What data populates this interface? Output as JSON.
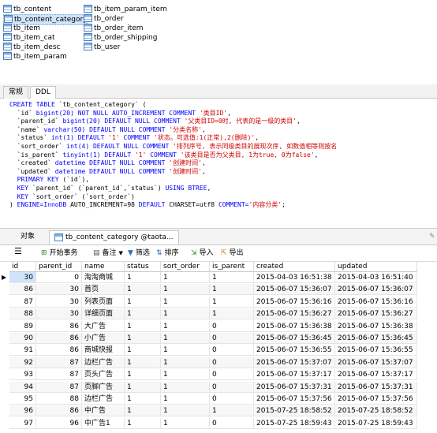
{
  "tables": {
    "col1": [
      "tb_content",
      "tb_content_category",
      "tb_item",
      "tb_item_cat",
      "tb_item_desc",
      "tb_item_param"
    ],
    "col2": [
      "tb_item_param_item",
      "tb_order",
      "tb_order_item",
      "tb_order_shipping",
      "tb_user"
    ],
    "selected": "tb_content_category"
  },
  "ddl_tabs": [
    "常规",
    "DDL"
  ],
  "ddl_lines": [
    [
      [
        "kw",
        "CREATE TABLE "
      ],
      [
        "nm",
        "`tb_content_category` ("
      ]
    ],
    [
      [
        "nm",
        "  `id` "
      ],
      [
        "kw",
        "bigint(20) NOT NULL AUTO_INCREMENT COMMENT "
      ],
      [
        "str",
        "'类目ID'"
      ],
      [
        "nm",
        ","
      ]
    ],
    [
      [
        "nm",
        "  `parent_id` "
      ],
      [
        "kw",
        "bigint(20) DEFAULT NULL COMMENT "
      ],
      [
        "str",
        "'父类目ID=0时, 代表的是一级的类目'"
      ],
      [
        "nm",
        ","
      ]
    ],
    [
      [
        "nm",
        "  `name` "
      ],
      [
        "kw",
        "varchar(50) DEFAULT NULL COMMENT "
      ],
      [
        "str",
        "'分类名称'"
      ],
      [
        "nm",
        ","
      ]
    ],
    [
      [
        "nm",
        "  `status` "
      ],
      [
        "kw",
        "int(1) DEFAULT "
      ],
      [
        "str",
        "'1'"
      ],
      [
        "kw",
        " COMMENT "
      ],
      [
        "str",
        "'状态。可选值:1(正常),2(删除)'"
      ],
      [
        "nm",
        ","
      ]
    ],
    [
      [
        "nm",
        "  `sort_order` "
      ],
      [
        "kw",
        "int(4) DEFAULT NULL COMMENT "
      ],
      [
        "str",
        "'排列序号, 表示同级类目的展现次序, 如数值相等则按名"
      ]
    ],
    [
      [
        "nm",
        "  `is_parent` "
      ],
      [
        "kw",
        "tinyint(1) DEFAULT "
      ],
      [
        "str",
        "'1'"
      ],
      [
        "kw",
        " COMMENT "
      ],
      [
        "str",
        "'该类目是否为父类目, 1为true, 0为false'"
      ],
      [
        "nm",
        ","
      ]
    ],
    [
      [
        "nm",
        "  `created` "
      ],
      [
        "kw",
        "datetime DEFAULT NULL COMMENT "
      ],
      [
        "str",
        "'创建时间'"
      ],
      [
        "nm",
        ","
      ]
    ],
    [
      [
        "nm",
        "  `updated` "
      ],
      [
        "kw",
        "datetime DEFAULT NULL COMMENT "
      ],
      [
        "str",
        "'创建时间'"
      ],
      [
        "nm",
        ","
      ]
    ],
    [
      [
        "kw",
        "  PRIMARY KEY "
      ],
      [
        "nm",
        "(`id`),"
      ]
    ],
    [
      [
        "kw",
        "  KEY "
      ],
      [
        "nm",
        "`parent_id` (`parent_id`,`status`) "
      ],
      [
        "kw",
        "USING BTREE"
      ],
      [
        "nm",
        ","
      ]
    ],
    [
      [
        "kw",
        "  KEY "
      ],
      [
        "nm",
        "`sort_order` (`sort_order`)"
      ]
    ],
    [
      [
        "nm",
        ") "
      ],
      [
        "kw",
        "ENGINE=InnoDB "
      ],
      [
        "nm",
        "AUTO_INCREMENT=98 "
      ],
      [
        "kw",
        "DEFAULT "
      ],
      [
        "nm",
        "CHARSET=utf8 "
      ],
      [
        "kw",
        "COMMENT="
      ],
      [
        "str",
        "'内容分类'"
      ],
      [
        "nm",
        ";"
      ]
    ]
  ],
  "object_tabs": [
    "对象",
    "tb_content_category @taota..."
  ],
  "toolbar": {
    "menu_icon": "hamburger-icon",
    "begin_tx": "开始事务",
    "note": "备注",
    "filter": "筛选",
    "sort": "排序",
    "import": "导入",
    "export": "导出"
  },
  "grid": {
    "columns": [
      "id",
      "parent_id",
      "name",
      "status",
      "sort_order",
      "is_parent",
      "created",
      "updated"
    ],
    "rows": [
      [
        "30",
        "0",
        "淘淘商城",
        "1",
        "1",
        "1",
        "2015-04-03 16:51:38",
        "2015-04-03 16:51:40"
      ],
      [
        "86",
        "30",
        "首页",
        "1",
        "1",
        "1",
        "2015-06-07 15:36:07",
        "2015-06-07 15:36:07"
      ],
      [
        "87",
        "30",
        "列表页面",
        "1",
        "1",
        "1",
        "2015-06-07 15:36:16",
        "2015-06-07 15:36:16"
      ],
      [
        "88",
        "30",
        "详细页面",
        "1",
        "1",
        "1",
        "2015-06-07 15:36:27",
        "2015-06-07 15:36:27"
      ],
      [
        "89",
        "86",
        "大广告",
        "1",
        "1",
        "0",
        "2015-06-07 15:36:38",
        "2015-06-07 15:36:38"
      ],
      [
        "90",
        "86",
        "小广告",
        "1",
        "1",
        "0",
        "2015-06-07 15:36:45",
        "2015-06-07 15:36:45"
      ],
      [
        "91",
        "86",
        "商城快报",
        "1",
        "1",
        "0",
        "2015-06-07 15:36:55",
        "2015-06-07 15:36:55"
      ],
      [
        "92",
        "87",
        "边栏广告",
        "1",
        "1",
        "0",
        "2015-06-07 15:37:07",
        "2015-06-07 15:37:07"
      ],
      [
        "93",
        "87",
        "页头广告",
        "1",
        "1",
        "0",
        "2015-06-07 15:37:17",
        "2015-06-07 15:37:17"
      ],
      [
        "94",
        "87",
        "页脚广告",
        "1",
        "1",
        "0",
        "2015-06-07 15:37:31",
        "2015-06-07 15:37:31"
      ],
      [
        "95",
        "88",
        "边栏广告",
        "1",
        "1",
        "0",
        "2015-06-07 15:37:56",
        "2015-06-07 15:37:56"
      ],
      [
        "96",
        "86",
        "中广告",
        "1",
        "1",
        "1",
        "2015-07-25 18:58:52",
        "2015-07-25 18:58:52"
      ],
      [
        "97",
        "96",
        "中广告1",
        "1",
        "1",
        "0",
        "2015-07-25 18:59:43",
        "2015-07-25 18:59:43"
      ]
    ]
  }
}
